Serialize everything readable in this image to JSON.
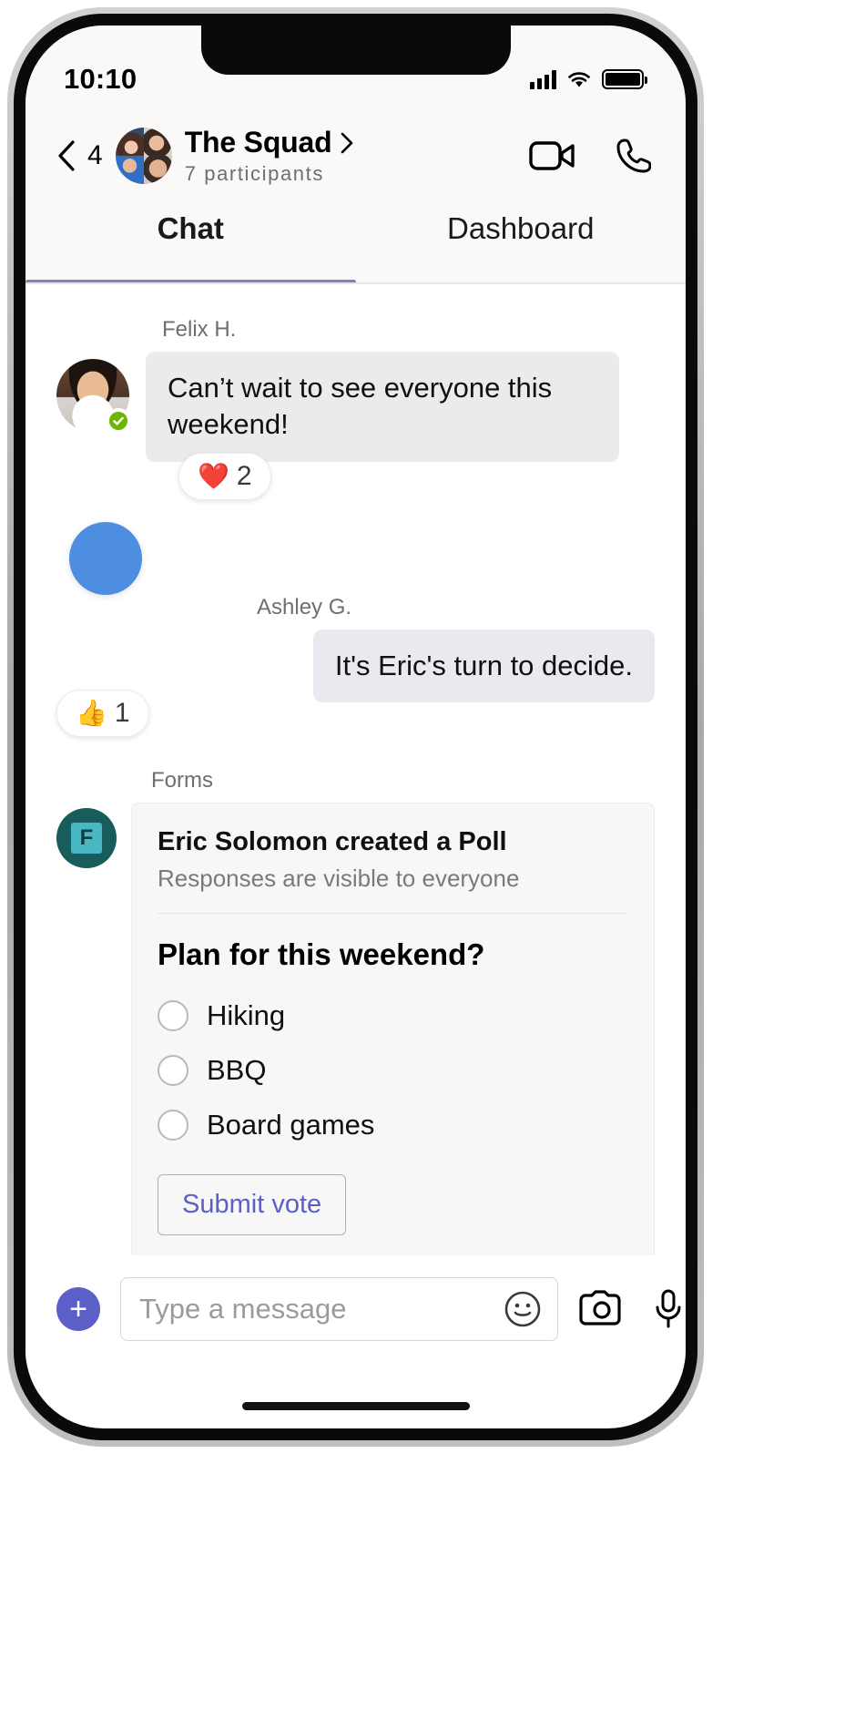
{
  "status_bar": {
    "time": "10:10",
    "signal_icon": "cellular-signal-icon",
    "wifi_icon": "wifi-icon",
    "battery_icon": "battery-icon"
  },
  "header": {
    "back_icon": "chevron-left-icon",
    "unread_count": "4",
    "avatar_name": "group-avatar",
    "title": "The Squad",
    "title_chevron_icon": "chevron-right-icon",
    "participants": "7 participants",
    "video_call_label": "video-call",
    "audio_call_label": "audio-call"
  },
  "tabs": [
    {
      "label": "Chat",
      "active": true
    },
    {
      "label": "Dashboard",
      "active": false
    }
  ],
  "accent": {
    "tab_indicator": "#7b83c4",
    "brand_purple": "#5b5fc7",
    "presence_green": "#6bb700",
    "forms_teal": "#185c5c"
  },
  "messages": [
    {
      "sender": "Felix H.",
      "text": "Can’t wait to see everyone this weekend!",
      "side": "left",
      "presence": "available",
      "reaction": {
        "emoji": "❤️",
        "name": "heart-reaction",
        "count": "2"
      }
    },
    {
      "sender": "Ashley G.",
      "text": "It's Eric's turn to decide.",
      "side": "right",
      "reaction": {
        "emoji": "👍",
        "name": "thumbs-up-reaction",
        "count": "1"
      }
    }
  ],
  "poll": {
    "app_label": "Forms",
    "app_icon": "microsoft-forms-icon",
    "app_icon_letter": "F",
    "creator_line": "Eric Solomon created a Poll",
    "visibility_line": "Responses are visible to everyone",
    "question": "Plan for this weekend?",
    "options": [
      "Hiking",
      "BBQ",
      "Board games"
    ],
    "submit_label": "Submit vote"
  },
  "composer": {
    "plus_icon": "plus-icon",
    "plus_label": "+",
    "placeholder": "Type a message",
    "value": "",
    "emoji_icon": "emoji-smiley-icon",
    "camera_icon": "camera-icon",
    "mic_icon": "microphone-icon"
  }
}
